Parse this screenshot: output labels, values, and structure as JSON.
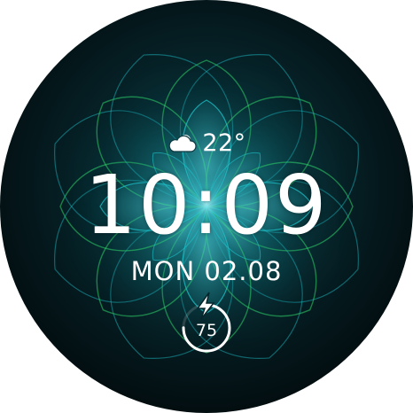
{
  "watchface": {
    "weather": {
      "icon": "cloud-sun-icon",
      "temperature": "22°"
    },
    "time": "10:09",
    "date": "MON 02.08",
    "battery": {
      "icon": "lightning-bolt-icon",
      "level": "75",
      "level_fraction": 0.75
    },
    "colors": {
      "background": "#03181c",
      "petal_teal": "#1ec8d0",
      "petal_green": "#2fd36a",
      "text": "#ffffff"
    }
  }
}
